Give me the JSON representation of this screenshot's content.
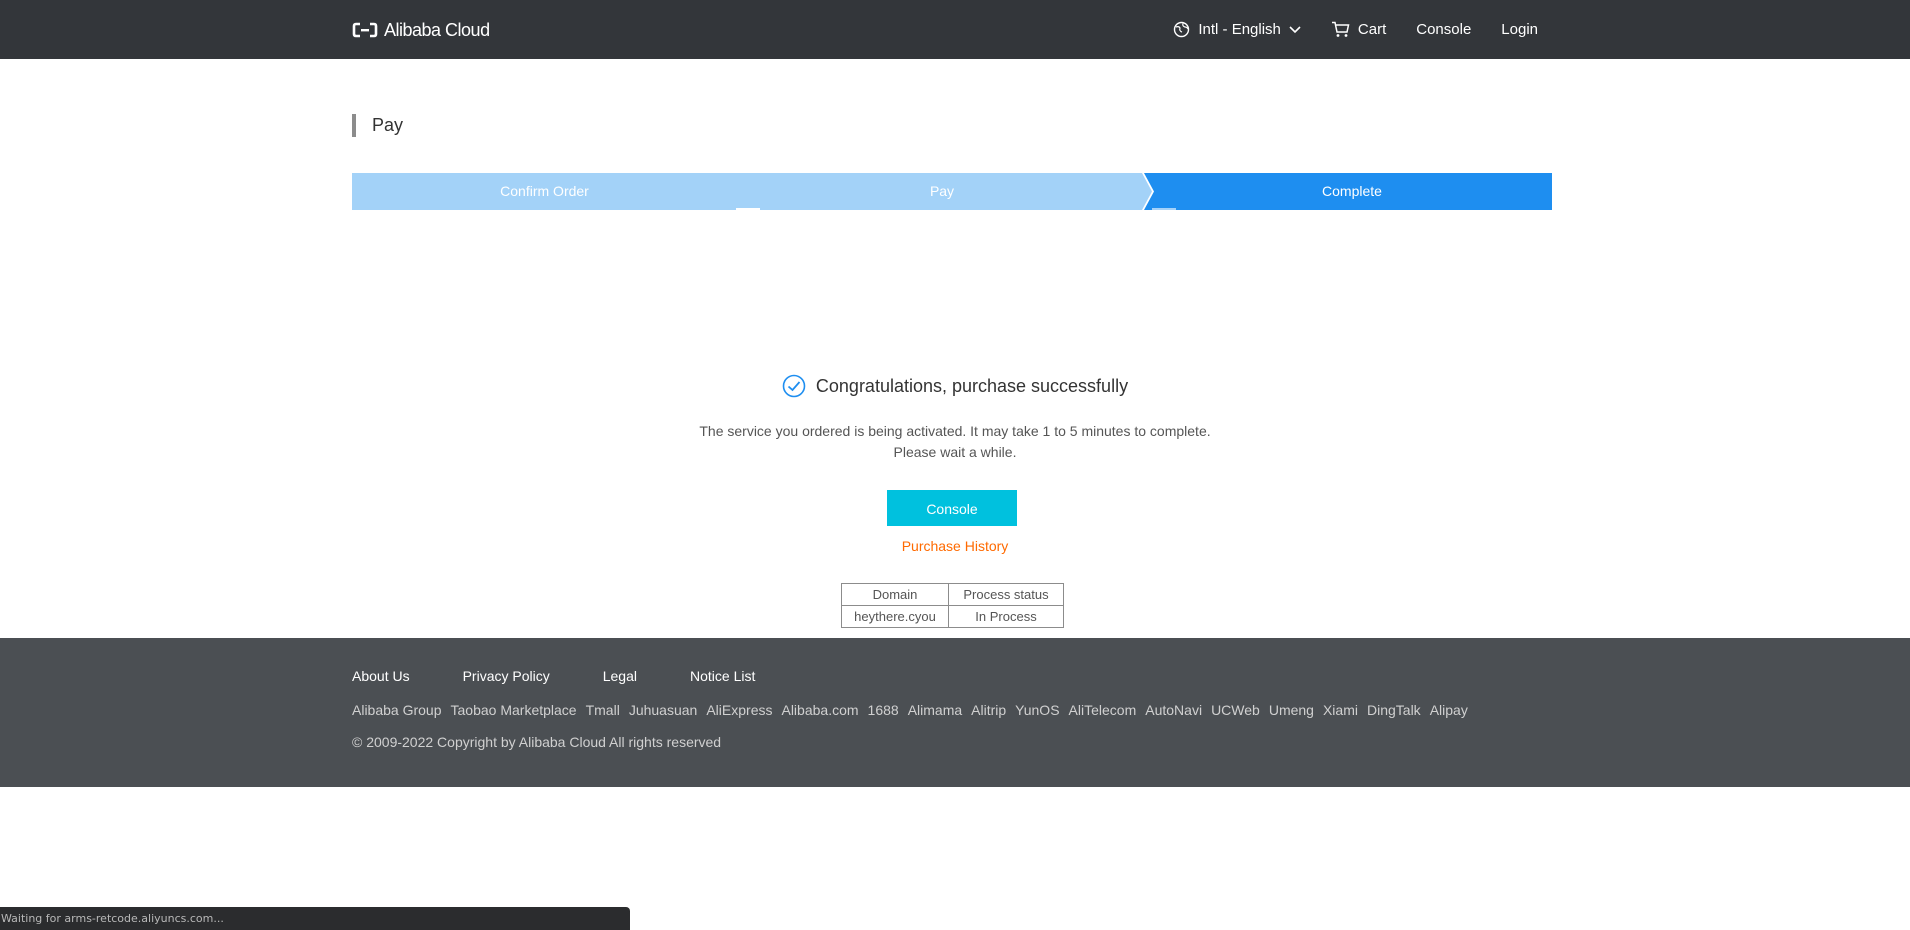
{
  "header": {
    "logo_text": "Alibaba Cloud",
    "language": "Intl - English",
    "cart": "Cart",
    "console": "Console",
    "login": "Login"
  },
  "page": {
    "title": "Pay"
  },
  "steps": [
    {
      "label": "Confirm Order",
      "state": "done"
    },
    {
      "label": "Pay",
      "state": "done"
    },
    {
      "label": "Complete",
      "state": "active"
    }
  ],
  "result": {
    "title": "Congratulations, purchase successfully",
    "desc_line1": "The service you ordered is being activated. It may take 1 to 5 minutes to complete.",
    "desc_line2": "Please wait a while.",
    "console_button": "Console",
    "history_link": "Purchase History"
  },
  "table": {
    "headers": [
      "Domain",
      "Process status"
    ],
    "rows": [
      [
        "heythere.cyou",
        "In Process"
      ]
    ]
  },
  "footer": {
    "links": [
      "About Us",
      "Privacy Policy",
      "Legal",
      "Notice List"
    ],
    "group": [
      "Alibaba Group",
      "Taobao Marketplace",
      "Tmall",
      "Juhuasuan",
      "AliExpress",
      "Alibaba.com",
      "1688",
      "Alimama",
      "Alitrip",
      "YunOS",
      "AliTelecom",
      "AutoNavi",
      "UCWeb",
      "Umeng",
      "Xiami",
      "DingTalk",
      "Alipay"
    ],
    "copyright": "© 2009-2022 Copyright by Alibaba Cloud All rights reserved"
  },
  "status_bar": {
    "text": "Waiting for arms-retcode.aliyuncs.com..."
  },
  "colors": {
    "header_bg": "#33363a",
    "step_done": "#a3d2f8",
    "step_active": "#1e8ef0",
    "console_button": "#00c1de",
    "history_link": "#ff6a00",
    "footer_bg": "#4b4f53",
    "success_icon": "#1e8ef0"
  }
}
